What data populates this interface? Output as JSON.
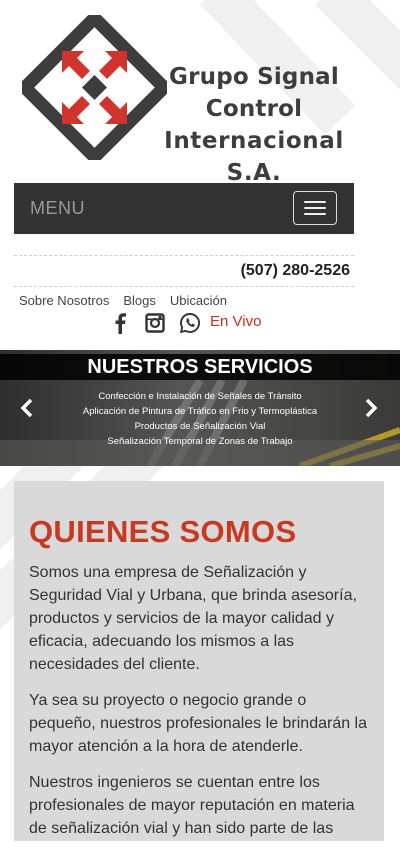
{
  "brand": {
    "name_line1": "Grupo Signal Control",
    "name_line2": "Internacional S.A."
  },
  "menu": {
    "label": "MENU",
    "toggle_icon": "hamburger-icon"
  },
  "contact": {
    "phone": "(507) 280-2526"
  },
  "nav": {
    "links": [
      "Sobre Nosotros",
      "Blogs",
      "Ubicación"
    ]
  },
  "social": {
    "icons": [
      "facebook-icon",
      "instagram-icon",
      "whatsapp-icon"
    ],
    "live_label": "En Vivo"
  },
  "services": {
    "title": "NUESTROS SERVICIOS",
    "items": [
      "Confección e Instalación de Señales de Tránsito",
      "Aplicación de Pintura de Tráfico en Frio y Termoplástica",
      "Productos de Señalización Vial",
      "Señalización Temporal de Zonas de Trabajo"
    ]
  },
  "about": {
    "heading": "QUIENES SOMOS",
    "paragraphs": [
      "Somos una empresa de Señalización y Seguridad Vial y Urbana, que brinda asesoría, productos y servicios de la mayor calidad y eficacia, adecuando los mismos a las necesidades del cliente.",
      "Ya sea su proyecto o negocio grande o pequeño, nuestros profesionales le brindarán la mayor atención a la hora de atenderle.",
      "Nuestros ingenieros se cuentan entre los profesionales de mayor reputación en materia de señalización vial y han sido parte de las"
    ]
  },
  "colors": {
    "accent_red": "#c73a22",
    "menu_bg": "#333333",
    "panel_bg": "#d9d9d9",
    "logo_gray": "#3d3d3d"
  }
}
